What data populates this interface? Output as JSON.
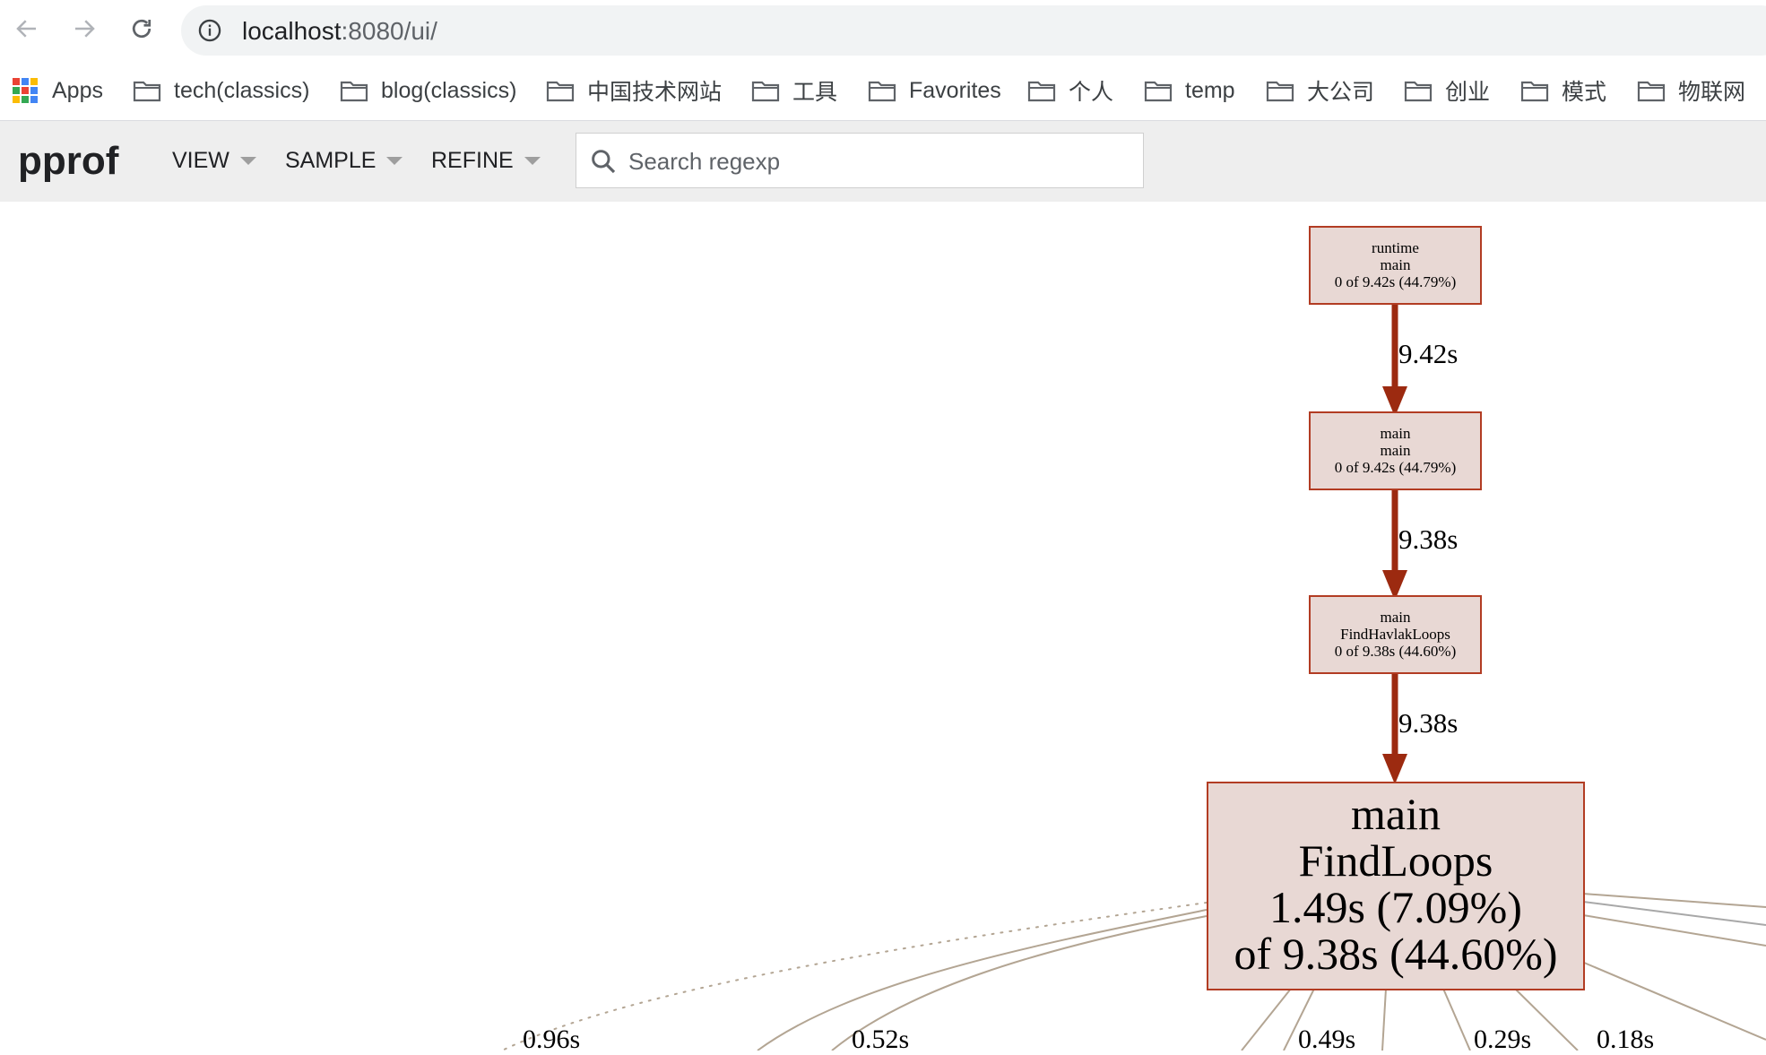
{
  "browser": {
    "url_host": "localhost",
    "url_path": ":8080/ui/",
    "bookmarks": [
      {
        "label": "Apps",
        "icon": "apps-grid-icon"
      },
      {
        "label": "tech(classics)",
        "icon": "folder-icon"
      },
      {
        "label": "blog(classics)",
        "icon": "folder-icon"
      },
      {
        "label": "中国技术网站",
        "icon": "folder-icon"
      },
      {
        "label": "工具",
        "icon": "folder-icon"
      },
      {
        "label": "Favorites",
        "icon": "folder-icon"
      },
      {
        "label": "个人",
        "icon": "folder-icon"
      },
      {
        "label": "temp",
        "icon": "folder-icon"
      },
      {
        "label": "大公司",
        "icon": "folder-icon"
      },
      {
        "label": "创业",
        "icon": "folder-icon"
      },
      {
        "label": "模式",
        "icon": "folder-icon"
      },
      {
        "label": "物联网",
        "icon": "folder-icon"
      }
    ]
  },
  "pprof": {
    "title": "pprof",
    "menus": [
      "VIEW",
      "SAMPLE",
      "REFINE"
    ],
    "search_placeholder": "Search regexp"
  },
  "graph": {
    "node_fill": "#e8d8d4",
    "node_border": "#b23c23",
    "hot_edge_color": "#9c2a10",
    "cold_edge_color": "#b3a593",
    "nodes": [
      {
        "lines": [
          "runtime",
          "main",
          "0 of 9.42s (44.79%)"
        ]
      },
      {
        "lines": [
          "main",
          "main",
          "0 of 9.42s (44.79%)"
        ]
      },
      {
        "lines": [
          "main",
          "FindHavlakLoops",
          "0 of 9.38s (44.60%)"
        ]
      },
      {
        "lines": [
          "main",
          "FindLoops",
          "1.49s (7.09%)",
          "of 9.38s (44.60%)"
        ]
      }
    ],
    "edge_labels": [
      "9.42s",
      "9.38s",
      "9.38s"
    ],
    "bottom_edge_labels": [
      "0.96s",
      "0.52s",
      "0.49s",
      "0.29s",
      "0.18s"
    ]
  }
}
